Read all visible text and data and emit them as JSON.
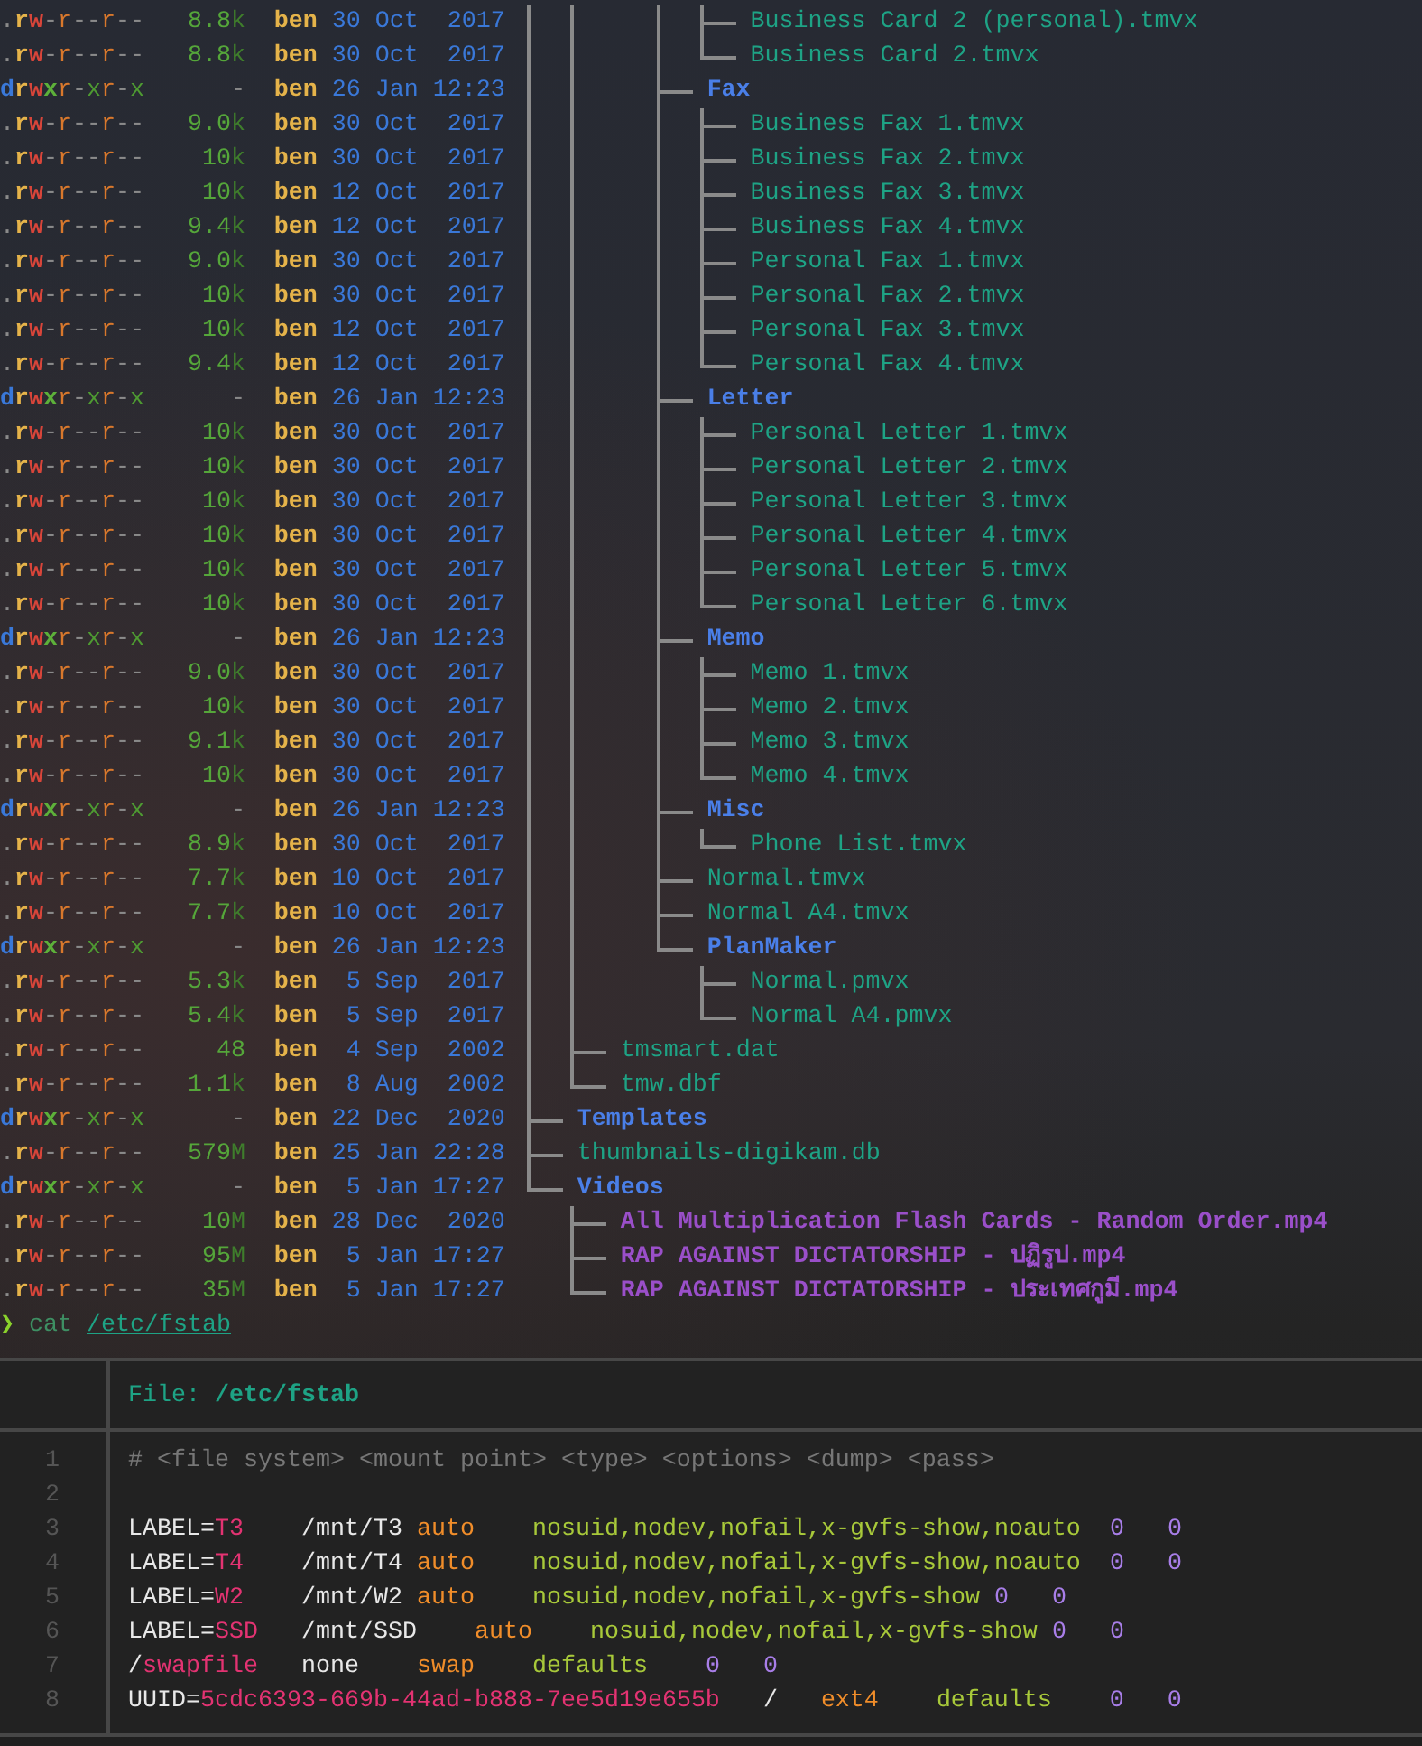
{
  "listing": {
    "entries": [
      {
        "children": [
          {
            "children": [
              {
                "children": [
                  {
                    "children": [
                      {
                        "permissions": ".rw-r--r--",
                        "size": "8.8",
                        "unit": "k",
                        "user": "ben",
                        "date": "30 Oct  2017",
                        "name": "Business Card 2 (personal).tmvx",
                        "kind": "file"
                      },
                      {
                        "permissions": ".rw-r--r--",
                        "size": "8.8",
                        "unit": "k",
                        "user": "ben",
                        "date": "30 Oct  2017",
                        "name": "Business Card 2.tmvx",
                        "kind": "file"
                      }
                    ]
                  },
                  {
                    "permissions": "drwxr-xr-x",
                    "size": "-",
                    "user": "ben",
                    "date": "26 Jan 12:23",
                    "name": "Fax",
                    "kind": "dir",
                    "children": [
                      {
                        "permissions": ".rw-r--r--",
                        "size": "9.0",
                        "unit": "k",
                        "user": "ben",
                        "date": "30 Oct  2017",
                        "name": "Business Fax 1.tmvx",
                        "kind": "file"
                      },
                      {
                        "permissions": ".rw-r--r--",
                        "size": "10",
                        "unit": "k",
                        "user": "ben",
                        "date": "30 Oct  2017",
                        "name": "Business Fax 2.tmvx",
                        "kind": "file"
                      },
                      {
                        "permissions": ".rw-r--r--",
                        "size": "10",
                        "unit": "k",
                        "user": "ben",
                        "date": "12 Oct  2017",
                        "name": "Business Fax 3.tmvx",
                        "kind": "file"
                      },
                      {
                        "permissions": ".rw-r--r--",
                        "size": "9.4",
                        "unit": "k",
                        "user": "ben",
                        "date": "12 Oct  2017",
                        "name": "Business Fax 4.tmvx",
                        "kind": "file"
                      },
                      {
                        "permissions": ".rw-r--r--",
                        "size": "9.0",
                        "unit": "k",
                        "user": "ben",
                        "date": "30 Oct  2017",
                        "name": "Personal Fax 1.tmvx",
                        "kind": "file"
                      },
                      {
                        "permissions": ".rw-r--r--",
                        "size": "10",
                        "unit": "k",
                        "user": "ben",
                        "date": "30 Oct  2017",
                        "name": "Personal Fax 2.tmvx",
                        "kind": "file"
                      },
                      {
                        "permissions": ".rw-r--r--",
                        "size": "10",
                        "unit": "k",
                        "user": "ben",
                        "date": "12 Oct  2017",
                        "name": "Personal Fax 3.tmvx",
                        "kind": "file"
                      },
                      {
                        "permissions": ".rw-r--r--",
                        "size": "9.4",
                        "unit": "k",
                        "user": "ben",
                        "date": "12 Oct  2017",
                        "name": "Personal Fax 4.tmvx",
                        "kind": "file"
                      }
                    ]
                  },
                  {
                    "permissions": "drwxr-xr-x",
                    "size": "-",
                    "user": "ben",
                    "date": "26 Jan 12:23",
                    "name": "Letter",
                    "kind": "dir",
                    "children": [
                      {
                        "permissions": ".rw-r--r--",
                        "size": "10",
                        "unit": "k",
                        "user": "ben",
                        "date": "30 Oct  2017",
                        "name": "Personal Letter 1.tmvx",
                        "kind": "file"
                      },
                      {
                        "permissions": ".rw-r--r--",
                        "size": "10",
                        "unit": "k",
                        "user": "ben",
                        "date": "30 Oct  2017",
                        "name": "Personal Letter 2.tmvx",
                        "kind": "file"
                      },
                      {
                        "permissions": ".rw-r--r--",
                        "size": "10",
                        "unit": "k",
                        "user": "ben",
                        "date": "30 Oct  2017",
                        "name": "Personal Letter 3.tmvx",
                        "kind": "file"
                      },
                      {
                        "permissions": ".rw-r--r--",
                        "size": "10",
                        "unit": "k",
                        "user": "ben",
                        "date": "30 Oct  2017",
                        "name": "Personal Letter 4.tmvx",
                        "kind": "file"
                      },
                      {
                        "permissions": ".rw-r--r--",
                        "size": "10",
                        "unit": "k",
                        "user": "ben",
                        "date": "30 Oct  2017",
                        "name": "Personal Letter 5.tmvx",
                        "kind": "file"
                      },
                      {
                        "permissions": ".rw-r--r--",
                        "size": "10",
                        "unit": "k",
                        "user": "ben",
                        "date": "30 Oct  2017",
                        "name": "Personal Letter 6.tmvx",
                        "kind": "file"
                      }
                    ]
                  },
                  {
                    "permissions": "drwxr-xr-x",
                    "size": "-",
                    "user": "ben",
                    "date": "26 Jan 12:23",
                    "name": "Memo",
                    "kind": "dir",
                    "children": [
                      {
                        "permissions": ".rw-r--r--",
                        "size": "9.0",
                        "unit": "k",
                        "user": "ben",
                        "date": "30 Oct  2017",
                        "name": "Memo 1.tmvx",
                        "kind": "file"
                      },
                      {
                        "permissions": ".rw-r--r--",
                        "size": "10",
                        "unit": "k",
                        "user": "ben",
                        "date": "30 Oct  2017",
                        "name": "Memo 2.tmvx",
                        "kind": "file"
                      },
                      {
                        "permissions": ".rw-r--r--",
                        "size": "9.1",
                        "unit": "k",
                        "user": "ben",
                        "date": "30 Oct  2017",
                        "name": "Memo 3.tmvx",
                        "kind": "file"
                      },
                      {
                        "permissions": ".rw-r--r--",
                        "size": "10",
                        "unit": "k",
                        "user": "ben",
                        "date": "30 Oct  2017",
                        "name": "Memo 4.tmvx",
                        "kind": "file"
                      }
                    ]
                  },
                  {
                    "permissions": "drwxr-xr-x",
                    "size": "-",
                    "user": "ben",
                    "date": "26 Jan 12:23",
                    "name": "Misc",
                    "kind": "dir",
                    "children": [
                      {
                        "permissions": ".rw-r--r--",
                        "size": "8.9",
                        "unit": "k",
                        "user": "ben",
                        "date": "30 Oct  2017",
                        "name": "Phone List.tmvx",
                        "kind": "file"
                      }
                    ]
                  },
                  {
                    "permissions": ".rw-r--r--",
                    "size": "7.7",
                    "unit": "k",
                    "user": "ben",
                    "date": "10 Oct  2017",
                    "name": "Normal.tmvx",
                    "kind": "file"
                  },
                  {
                    "permissions": ".rw-r--r--",
                    "size": "7.7",
                    "unit": "k",
                    "user": "ben",
                    "date": "10 Oct  2017",
                    "name": "Normal A4.tmvx",
                    "kind": "file"
                  },
                  {
                    "permissions": "drwxr-xr-x",
                    "size": "-",
                    "user": "ben",
                    "date": "26 Jan 12:23",
                    "name": "PlanMaker",
                    "kind": "dir",
                    "children": [
                      {
                        "permissions": ".rw-r--r--",
                        "size": "5.3",
                        "unit": "k",
                        "user": "ben",
                        "date": "5 Sep  2017",
                        "name": "Normal.pmvx",
                        "kind": "file"
                      },
                      {
                        "permissions": ".rw-r--r--",
                        "size": "5.4",
                        "unit": "k",
                        "user": "ben",
                        "date": "5 Sep  2017",
                        "name": "Normal A4.pmvx",
                        "kind": "file"
                      }
                    ]
                  }
                ]
              }
            ]
          },
          {
            "permissions": ".rw-r--r--",
            "size": "48",
            "user": "ben",
            "date": "4 Sep  2002",
            "name": "tmsmart.dat",
            "kind": "file"
          },
          {
            "permissions": ".rw-r--r--",
            "size": "1.1",
            "unit": "k",
            "user": "ben",
            "date": "8 Aug  2002",
            "name": "tmw.dbf",
            "kind": "file"
          }
        ]
      },
      {
        "permissions": "drwxr-xr-x",
        "size": "-",
        "user": "ben",
        "date": "22 Dec  2020",
        "name": "Templates",
        "kind": "dir"
      },
      {
        "permissions": ".rw-r--r--",
        "size": "579",
        "unit": "M",
        "user": "ben",
        "date": "25 Jan 22:28",
        "name": "thumbnails-digikam.db",
        "kind": "file"
      },
      {
        "permissions": "drwxr-xr-x",
        "size": "-",
        "user": "ben",
        "date": "5 Jan 17:27",
        "name": "Videos",
        "kind": "dir",
        "children": [
          {
            "permissions": ".rw-r--r--",
            "size": "10",
            "unit": "M",
            "user": "ben",
            "date": "28 Dec  2020",
            "name": "All Multiplication Flash Cards - Random Order.mp4",
            "kind": "video"
          },
          {
            "permissions": ".rw-r--r--",
            "size": "95",
            "unit": "M",
            "user": "ben",
            "date": "5 Jan 17:27",
            "name": "RAP AGAINST DICTATORSHIP - ปฏิรูป.mp4",
            "kind": "video"
          },
          {
            "permissions": ".rw-r--r--",
            "size": "35",
            "unit": "M",
            "user": "ben",
            "date": "5 Jan 17:27",
            "name": "RAP AGAINST DICTATORSHIP - ประเทศกูมี.mp4",
            "kind": "video"
          }
        ]
      }
    ]
  },
  "prompt": {
    "symbol": "❯",
    "command": "cat",
    "argument": "/etc/fstab"
  },
  "viewer": {
    "header_label": "File:",
    "file_path": "/etc/fstab",
    "lines": [
      {
        "number": "1",
        "tokens": [
          {
            "text": "# <file system> <mount point> <type> <options> <dump> <pass>",
            "kind": "comment"
          }
        ]
      },
      {
        "number": "2"
      },
      {
        "number": "3",
        "tokens": [
          {
            "text": "LABEL=",
            "kind": "plain"
          },
          {
            "text": "T3    ",
            "kind": "label"
          },
          {
            "text": "/mnt/T3 ",
            "kind": "plain"
          },
          {
            "text": "auto    ",
            "kind": "fstype"
          },
          {
            "text": "nosuid,nodev,nofail,x-gvfs-show,noauto  ",
            "kind": "options"
          },
          {
            "text": "0   ",
            "kind": "number"
          },
          {
            "text": "0",
            "kind": "number"
          }
        ]
      },
      {
        "number": "4",
        "tokens": [
          {
            "text": "LABEL=",
            "kind": "plain"
          },
          {
            "text": "T4    ",
            "kind": "label"
          },
          {
            "text": "/mnt/T4 ",
            "kind": "plain"
          },
          {
            "text": "auto    ",
            "kind": "fstype"
          },
          {
            "text": "nosuid,nodev,nofail,x-gvfs-show,noauto  ",
            "kind": "options"
          },
          {
            "text": "0   ",
            "kind": "number"
          },
          {
            "text": "0",
            "kind": "number"
          }
        ]
      },
      {
        "number": "5",
        "tokens": [
          {
            "text": "LABEL=",
            "kind": "plain"
          },
          {
            "text": "W2    ",
            "kind": "label"
          },
          {
            "text": "/mnt/W2 ",
            "kind": "plain"
          },
          {
            "text": "auto    ",
            "kind": "fstype"
          },
          {
            "text": "nosuid,nodev,nofail,x-gvfs-show ",
            "kind": "options"
          },
          {
            "text": "0   ",
            "kind": "number"
          },
          {
            "text": "0",
            "kind": "number"
          }
        ]
      },
      {
        "number": "6",
        "tokens": [
          {
            "text": "LABEL=",
            "kind": "plain"
          },
          {
            "text": "SSD   ",
            "kind": "label"
          },
          {
            "text": "/mnt/SSD    ",
            "kind": "plain"
          },
          {
            "text": "auto    ",
            "kind": "fstype"
          },
          {
            "text": "nosuid,nodev,nofail,x-gvfs-show ",
            "kind": "options"
          },
          {
            "text": "0   ",
            "kind": "number"
          },
          {
            "text": "0",
            "kind": "number"
          }
        ]
      },
      {
        "number": "7",
        "tokens": [
          {
            "text": "/",
            "kind": "plain"
          },
          {
            "text": "swapfile   ",
            "kind": "label"
          },
          {
            "text": "none    ",
            "kind": "plain"
          },
          {
            "text": "swap    ",
            "kind": "fstype"
          },
          {
            "text": "defaults    ",
            "kind": "options"
          },
          {
            "text": "0   ",
            "kind": "number"
          },
          {
            "text": "0",
            "kind": "number"
          }
        ]
      },
      {
        "number": "8",
        "tokens": [
          {
            "text": "UUID=",
            "kind": "plain"
          },
          {
            "text": "5cdc6393-669b-44ad-b888-7ee5d19e655b   ",
            "kind": "label"
          },
          {
            "text": "/   ",
            "kind": "plain"
          },
          {
            "text": "ext4    ",
            "kind": "fstype"
          },
          {
            "text": "defaults    ",
            "kind": "options"
          },
          {
            "text": "0   ",
            "kind": "number"
          },
          {
            "text": "0",
            "kind": "number"
          }
        ]
      }
    ]
  }
}
